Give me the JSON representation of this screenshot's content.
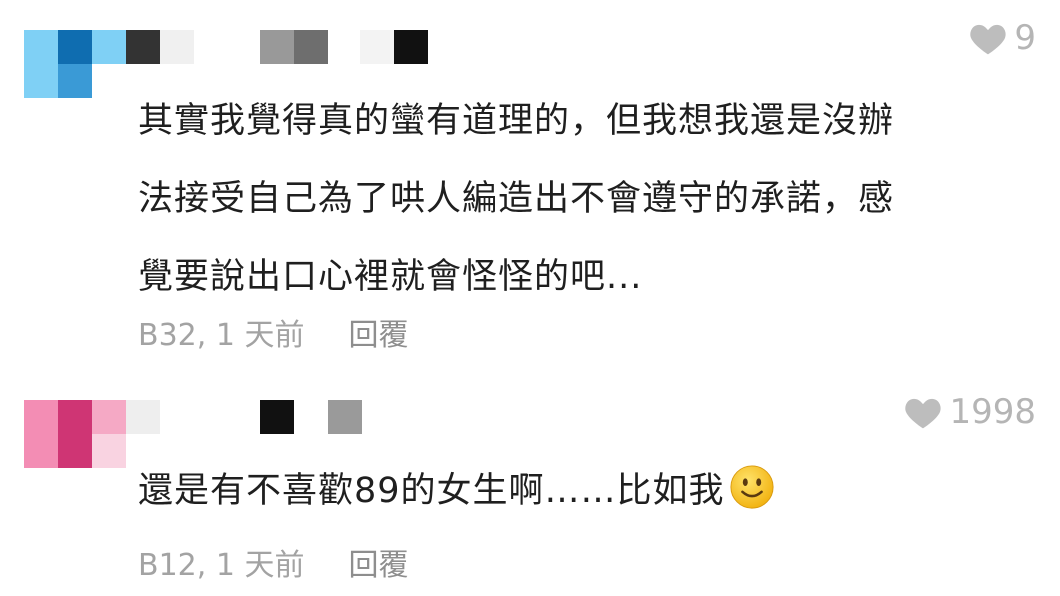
{
  "comments": [
    {
      "likes": "9",
      "text": "其實我覺得真的蠻有道理的，但我想我還是沒辦\n法接受自己為了哄人編造出不會遵守的承諾，感\n覺要說出口心裡就會怪怪的吧...",
      "author_tag": "B32",
      "time": "1 天前",
      "reply_label": "回覆",
      "mosaic_colors": [
        "#7fd0f5",
        "#2f8fc8",
        "#f0f0f0",
        "#333333",
        "#f7f7f7",
        "#8a8a8a",
        "#6e6e6e",
        "#f2f2f2",
        "#111111"
      ]
    },
    {
      "likes": "1998",
      "text": "還是有不喜歡89的女生啊……比如我",
      "emoji": "slightly-smiling-face",
      "author_tag": "B12",
      "time": "1 天前",
      "reply_label": "回覆",
      "mosaic_colors": [
        "#f07fa8",
        "#c8366e",
        "#f4a8c2",
        "#eeeeee",
        "#111111",
        "#9a9a9a"
      ]
    }
  ],
  "colors": {
    "like_grey": "#b5b5b5",
    "meta_grey": "#a3a3a3",
    "emoji_yellow": "#f6c21c"
  }
}
